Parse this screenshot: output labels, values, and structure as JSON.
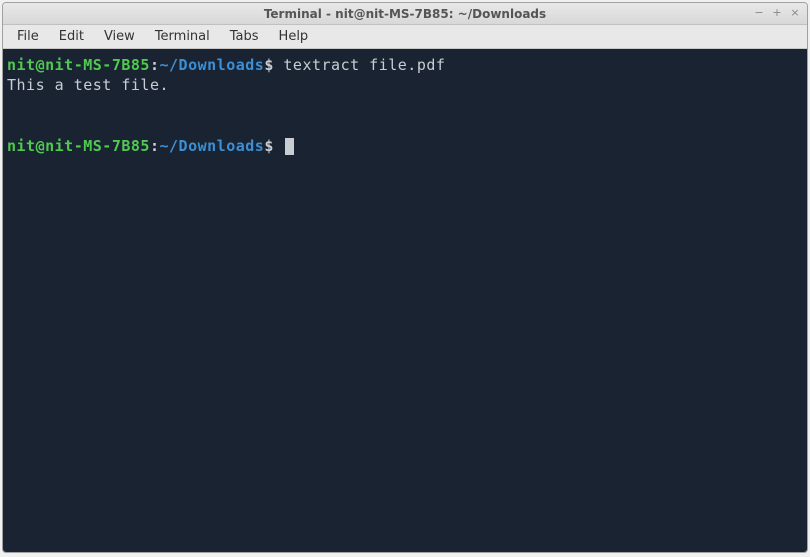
{
  "window": {
    "title": "Terminal - nit@nit-MS-7B85: ~/Downloads"
  },
  "controls": {
    "minimize": "−",
    "maximize": "+",
    "close": "×"
  },
  "menubar": {
    "items": [
      {
        "label": "File"
      },
      {
        "label": "Edit"
      },
      {
        "label": "View"
      },
      {
        "label": "Terminal"
      },
      {
        "label": "Tabs"
      },
      {
        "label": "Help"
      }
    ]
  },
  "prompt": {
    "user_host": "nit@nit-MS-7B85",
    "colon": ":",
    "path": "~/Downloads",
    "symbol": "$"
  },
  "session": {
    "command1": " textract file.pdf",
    "output1": "This a test file."
  }
}
